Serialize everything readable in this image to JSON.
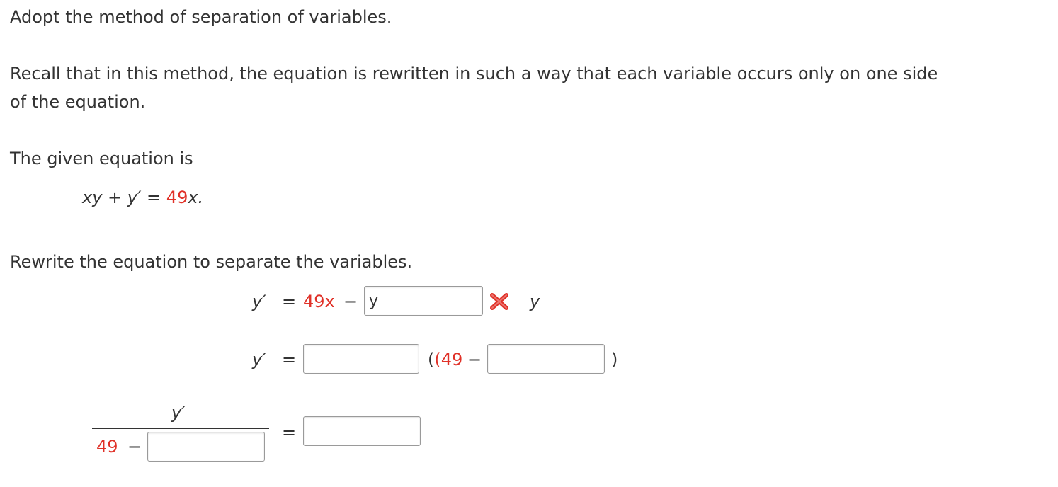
{
  "instructions": {
    "method": "Adopt the method of separation of variables.",
    "recall_line1": "Recall that in this method, the equation is rewritten in such a way that each variable occurs only on one side",
    "recall_line2": "of the equation.",
    "given_intro": "The given equation is",
    "rewrite_prompt": "Rewrite the equation to separate the variables."
  },
  "given_equation": {
    "lhs": "xy + y′ = ",
    "coefficient": "49",
    "variable_end": "x."
  },
  "step1": {
    "lhs": "y′",
    "equals": "=",
    "coef_term": "49x",
    "minus": "−",
    "answer_value": "y",
    "answer_status": "incorrect",
    "trailing_variable": "y"
  },
  "step2": {
    "lhs": "y′",
    "equals": "=",
    "open_paren_number": "(49",
    "minus": "−",
    "close_paren": ")",
    "answer1_value": "",
    "answer2_value": ""
  },
  "step3": {
    "numerator": "y′",
    "denominator_number": "49",
    "minus": "−",
    "equals": "=",
    "denominator_answer_value": "",
    "rhs_answer_value": ""
  },
  "colors": {
    "text": "#333333",
    "given_number_red": "#e03128",
    "wrong_mark": "#e03128",
    "input_border": "#9a9a9a"
  },
  "icons": {
    "wrong_answer": "x-mark-icon"
  }
}
